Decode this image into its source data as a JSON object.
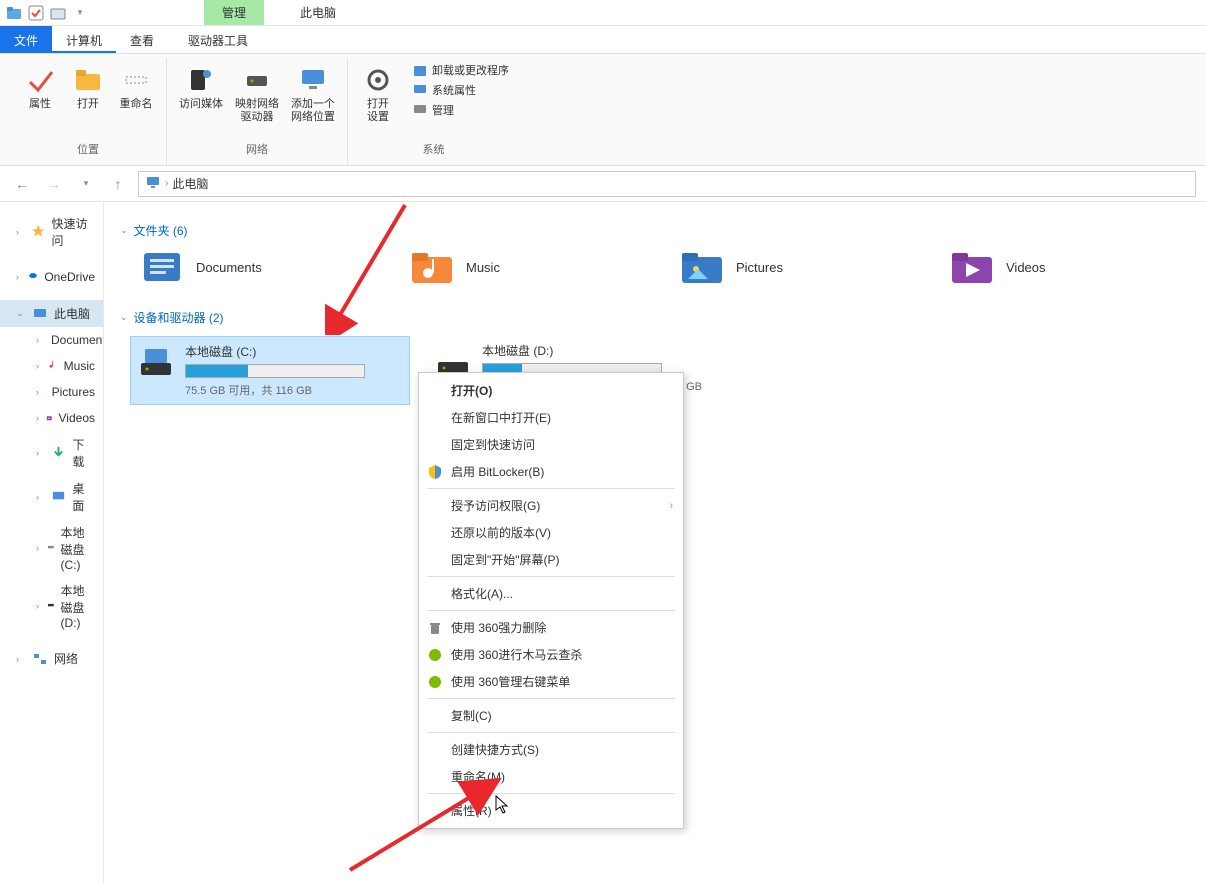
{
  "titlebar": {
    "manage_tab": "管理",
    "window_title": "此电脑"
  },
  "ribbon_tabs": {
    "file": "文件",
    "computer": "计算机",
    "view": "查看",
    "drive_tools": "驱动器工具"
  },
  "ribbon": {
    "group_location": "位置",
    "group_network": "网络",
    "group_system": "系统",
    "properties": "属性",
    "open": "打开",
    "rename": "重命名",
    "access_media": "访问媒体",
    "map_drive": "映射网络\n驱动器",
    "add_network": "添加一个\n网络位置",
    "open_settings": "打开\n设置",
    "uninstall": "卸载或更改程序",
    "sys_props": "系统属性",
    "manage": "管理"
  },
  "breadcrumb": {
    "root": "此电脑"
  },
  "sidebar": {
    "quick_access": "快速访问",
    "onedrive": "OneDrive",
    "this_pc": "此电脑",
    "documents": "Documents",
    "music": "Music",
    "pictures": "Pictures",
    "videos": "Videos",
    "downloads": "下载",
    "desktop": "桌面",
    "drive_c": "本地磁盘 (C:)",
    "drive_d": "本地磁盘 (D:)",
    "network": "网络"
  },
  "sections": {
    "folders": "文件夹 (6)",
    "devices": "设备和驱动器 (2)"
  },
  "folders": {
    "documents": "Documents",
    "music": "Music",
    "pictures": "Pictures",
    "videos": "Videos"
  },
  "drives": {
    "c": {
      "name": "本地磁盘 (C:)",
      "capacity": "75.5 GB 可用，共 116 GB",
      "fill_pct": 35
    },
    "d": {
      "name": "本地磁盘 (D:)",
      "capacity_suffix": "GB",
      "fill_pct": 22
    }
  },
  "context_menu": {
    "open": "打开(O)",
    "open_new_window": "在新窗口中打开(E)",
    "pin_quick_access": "固定到快速访问",
    "enable_bitlocker": "启用 BitLocker(B)",
    "grant_access": "授予访问权限(G)",
    "restore_previous": "还原以前的版本(V)",
    "pin_start": "固定到\"开始\"屏幕(P)",
    "format": "格式化(A)...",
    "use_360_force_delete": "使用 360强力删除",
    "use_360_trojan_scan": "使用 360进行木马云查杀",
    "use_360_manage_menu": "使用 360管理右键菜单",
    "copy": "复制(C)",
    "create_shortcut": "创建快捷方式(S)",
    "rename": "重命名(M)",
    "properties": "属性(R)"
  }
}
